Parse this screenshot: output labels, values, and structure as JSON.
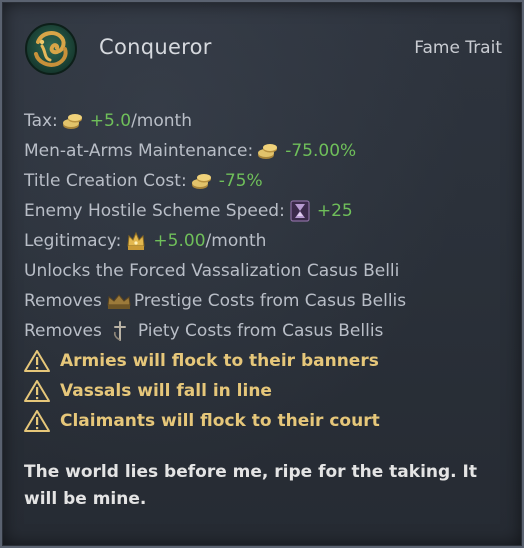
{
  "trait": {
    "name": "Conqueror",
    "type": "Fame Trait",
    "icon": "conqueror-trait-icon"
  },
  "modifiers": {
    "tax_label": "Tax:",
    "tax_value": "+5.0",
    "tax_unit": "/month",
    "maa_label": "Men-at-Arms Maintenance:",
    "maa_value": "-75.00%",
    "title_label": "Title Creation Cost:",
    "title_value": "-75%",
    "scheme_label": "Enemy Hostile Scheme Speed:",
    "scheme_value": "+25",
    "legitimacy_label": "Legitimacy:",
    "legitimacy_value": "+5.00",
    "legitimacy_unit": "/month",
    "unlocks": "Unlocks the Forced Vassalization Casus Belli",
    "prestige_prefix": "Removes",
    "prestige_suffix": "Prestige Costs from Casus Bellis",
    "piety_prefix": "Removes",
    "piety_suffix": "Piety Costs from Casus Bellis"
  },
  "warnings": [
    "Armies will flock to their banners",
    "Vassals will fall in line",
    "Claimants will flock to their court"
  ],
  "flavor": "The world lies before me, ripe for the taking. It will be mine.",
  "colors": {
    "positive": "#6fbf5a",
    "warning": "#e6c77a"
  }
}
